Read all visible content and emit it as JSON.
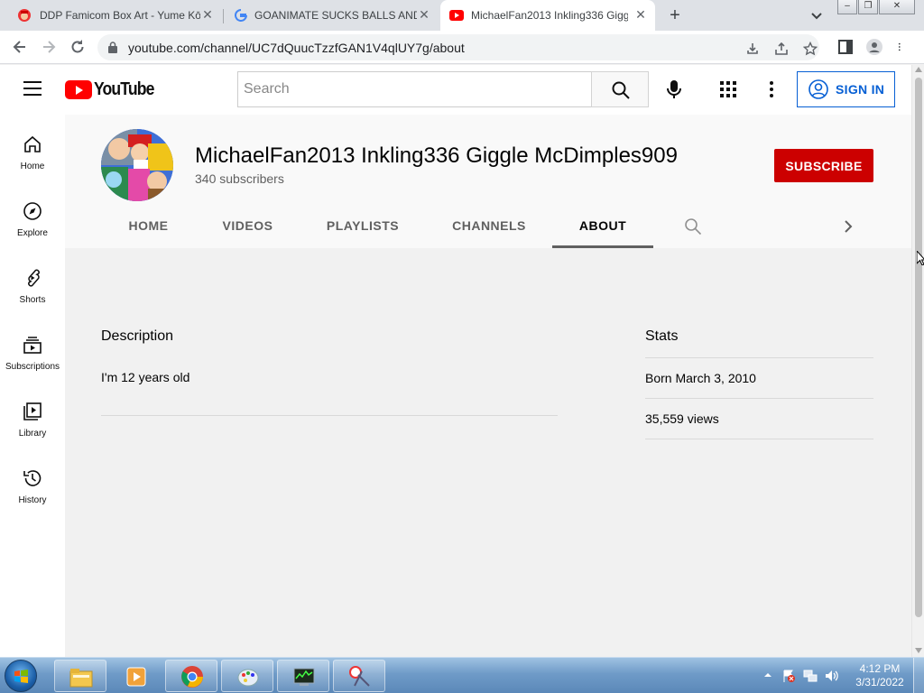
{
  "browser": {
    "tabs": [
      {
        "title": "DDP Famicom Box Art - Yume Kō",
        "close": "✕",
        "active": false
      },
      {
        "title": "GOANIMATE SUCKS BALLS AND",
        "close": "✕",
        "active": false
      },
      {
        "title": "MichaelFan2013 Inkling336 Gigg",
        "close": "✕",
        "active": true
      }
    ],
    "new_tab": "+",
    "url": "youtube.com/channel/UC7dQuucTzzfGAN1V4qlUY7g/about",
    "window_buttons": {
      "minimize": "–",
      "restore": "❐",
      "close": "✕"
    }
  },
  "youtube": {
    "logo_text": "YouTube",
    "search_placeholder": "Search",
    "sign_in_label": "SIGN IN",
    "brand_red": "#ff0000",
    "link_blue": "#065fd4"
  },
  "guide": {
    "items": [
      {
        "label": "Home",
        "icon": "home-icon"
      },
      {
        "label": "Explore",
        "icon": "compass-icon"
      },
      {
        "label": "Shorts",
        "icon": "shorts-icon"
      },
      {
        "label": "Subscriptions",
        "icon": "subscriptions-icon"
      },
      {
        "label": "Library",
        "icon": "library-icon"
      },
      {
        "label": "History",
        "icon": "history-icon"
      }
    ]
  },
  "channel": {
    "name": "MichaelFan2013 Inkling336 Giggle McDimples909",
    "subscribers": "340 subscribers",
    "subscribe_label": "SUBSCRIBE",
    "subscribe_color": "#cc0000",
    "tabs": [
      "HOME",
      "VIDEOS",
      "PLAYLISTS",
      "CHANNELS",
      "ABOUT"
    ],
    "active_tab": "ABOUT"
  },
  "about": {
    "description_heading": "Description",
    "description_text": "I'm 12 years old",
    "stats_heading": "Stats",
    "stats": [
      "Born March 3, 2010",
      "35,559 views"
    ]
  },
  "taskbar": {
    "apps": [
      "file-explorer-icon",
      "media-player-icon",
      "chrome-icon",
      "paint-app-icon",
      "task-manager-icon",
      "snipping-tool-icon"
    ],
    "time": "4:12 PM",
    "date": "3/31/2022"
  }
}
